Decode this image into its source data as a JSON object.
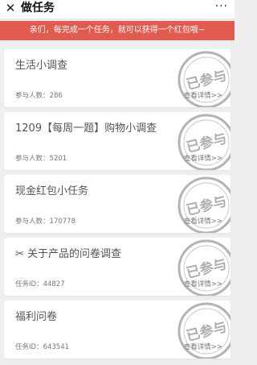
{
  "header": {
    "close_glyph": "✕",
    "title": "做任务",
    "more_glyph": "···"
  },
  "notice": "亲们，每完成一个任务，就可以获得一个红包哦~",
  "tasks": [
    {
      "title": "生活小调查",
      "meta_label": "参与人数",
      "meta_value": "286",
      "detail": "查看详情>>"
    },
    {
      "title": "1209【每周一题】购物小调查",
      "meta_label": "参与人数",
      "meta_value": "5201",
      "detail": "查看详情>>"
    },
    {
      "title": "现金红包小任务",
      "meta_label": "参与人数",
      "meta_value": "170778",
      "detail": "查看详情>>"
    },
    {
      "title": "✂ 关于产品的问卷调查",
      "meta_label": "任务ID",
      "meta_value": "44827",
      "detail": "查看详情>>"
    },
    {
      "title": "福利问卷",
      "meta_label": "任务ID",
      "meta_value": "643541",
      "detail": "查看详情>>"
    }
  ],
  "stamp_text": "已参与",
  "colors": {
    "notice_bg": "#e25b4f",
    "stamp": "#9a9a9a"
  }
}
